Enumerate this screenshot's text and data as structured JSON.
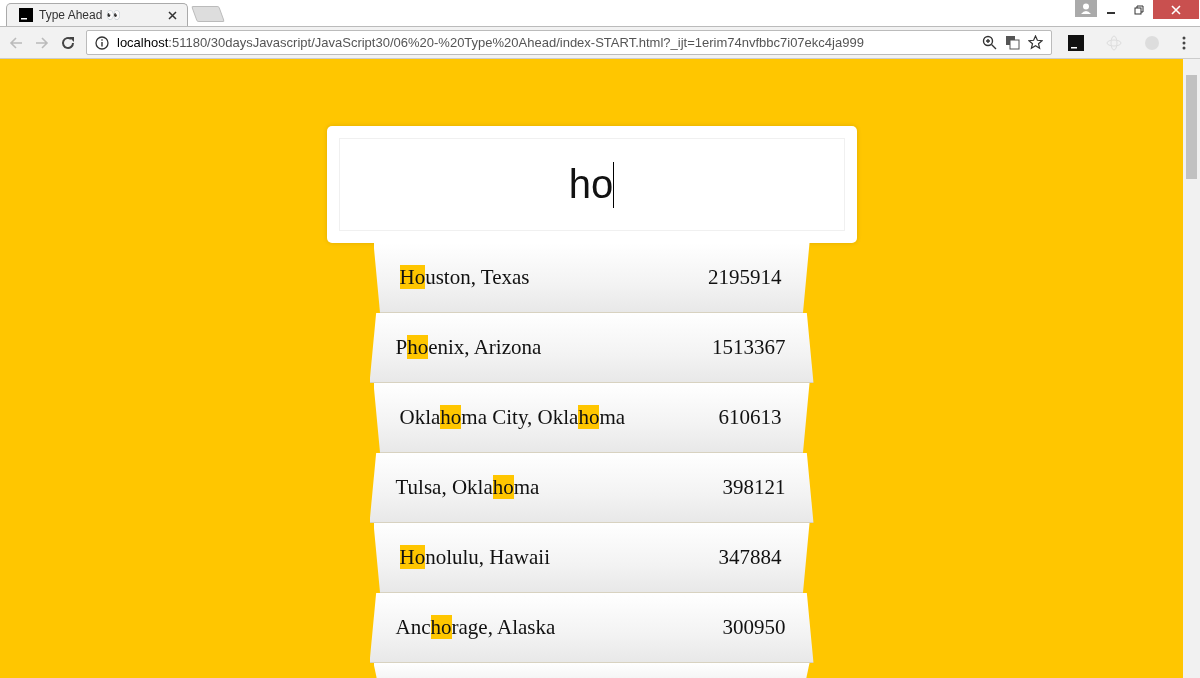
{
  "browser": {
    "tabs": [
      {
        "title": "Type Ahead 👀",
        "selected": true
      }
    ],
    "address": {
      "host": "localhost",
      "path": ":51180/30daysJavascript/JavaScript30/06%20-%20Type%20Ahead/index-START.html?_ijt=1erim74nvfbbc7i07ekc4ja999"
    }
  },
  "search": {
    "value": "ho"
  },
  "suggestions": [
    {
      "parts": [
        {
          "text": "Ho",
          "match": true
        },
        {
          "text": "uston, Texas",
          "match": false
        }
      ],
      "population": "2195914"
    },
    {
      "parts": [
        {
          "text": "P",
          "match": false
        },
        {
          "text": "ho",
          "match": true
        },
        {
          "text": "enix, Arizona",
          "match": false
        }
      ],
      "population": "1513367"
    },
    {
      "parts": [
        {
          "text": "Okla",
          "match": false
        },
        {
          "text": "ho",
          "match": true
        },
        {
          "text": "ma City, Okla",
          "match": false
        },
        {
          "text": "ho",
          "match": true
        },
        {
          "text": "ma",
          "match": false
        }
      ],
      "population": "610613"
    },
    {
      "parts": [
        {
          "text": "Tulsa, Okla",
          "match": false
        },
        {
          "text": "ho",
          "match": true
        },
        {
          "text": "ma",
          "match": false
        }
      ],
      "population": "398121"
    },
    {
      "parts": [
        {
          "text": "Ho",
          "match": true
        },
        {
          "text": "nolulu, Hawaii",
          "match": false
        }
      ],
      "population": "347884"
    },
    {
      "parts": [
        {
          "text": "Anc",
          "match": false
        },
        {
          "text": "ho",
          "match": true
        },
        {
          "text": "rage, Alaska",
          "match": false
        }
      ],
      "population": "300950"
    }
  ]
}
